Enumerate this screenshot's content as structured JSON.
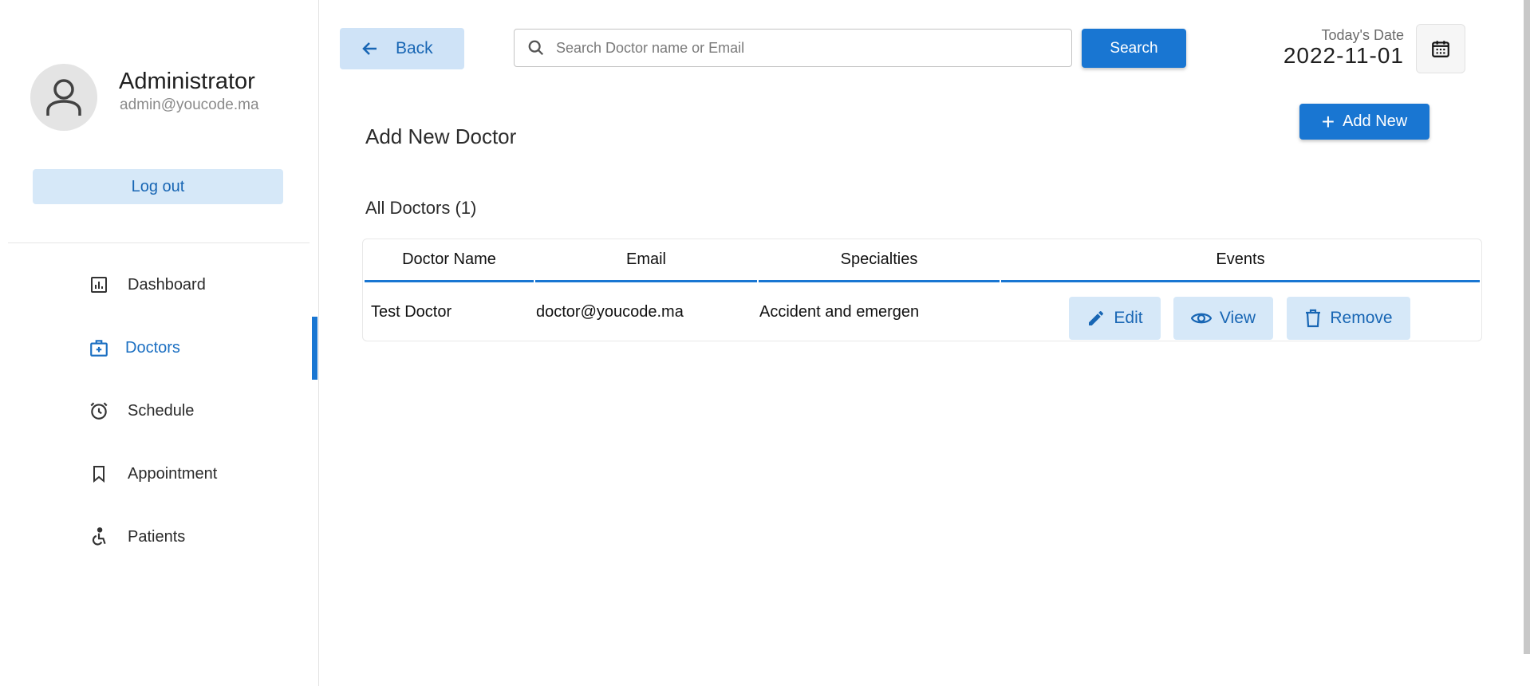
{
  "profile": {
    "name": "Administrator",
    "email": "admin@youcode.ma",
    "logout_label": "Log out"
  },
  "nav": {
    "items": [
      {
        "label": "Dashboard",
        "icon": "chart-icon",
        "active": false
      },
      {
        "label": "Doctors",
        "icon": "medical-bag-icon",
        "active": true
      },
      {
        "label": "Schedule",
        "icon": "alarm-clock-icon",
        "active": false
      },
      {
        "label": "Appointment",
        "icon": "bookmark-icon",
        "active": false
      },
      {
        "label": "Patients",
        "icon": "accessible-icon",
        "active": false
      }
    ]
  },
  "header": {
    "back_label": "Back",
    "search_placeholder": "Search Doctor name or Email",
    "search_button": "Search",
    "date_label": "Today's Date",
    "date_value": "2022-11-01"
  },
  "main": {
    "page_title": "Add New Doctor",
    "add_new_label": "Add New",
    "section_title": "All Doctors (1)",
    "columns": [
      "Doctor Name",
      "Email",
      "Specialties",
      "Events"
    ],
    "rows": [
      {
        "name": "Test Doctor",
        "email": "doctor@youcode.ma",
        "specialties": "Accident and emergen",
        "actions": {
          "edit": "Edit",
          "view": "View",
          "remove": "Remove"
        }
      }
    ]
  },
  "colors": {
    "accent": "#1976d2",
    "accent_light": "#d6e8f8",
    "accent_text": "#1866b4"
  }
}
